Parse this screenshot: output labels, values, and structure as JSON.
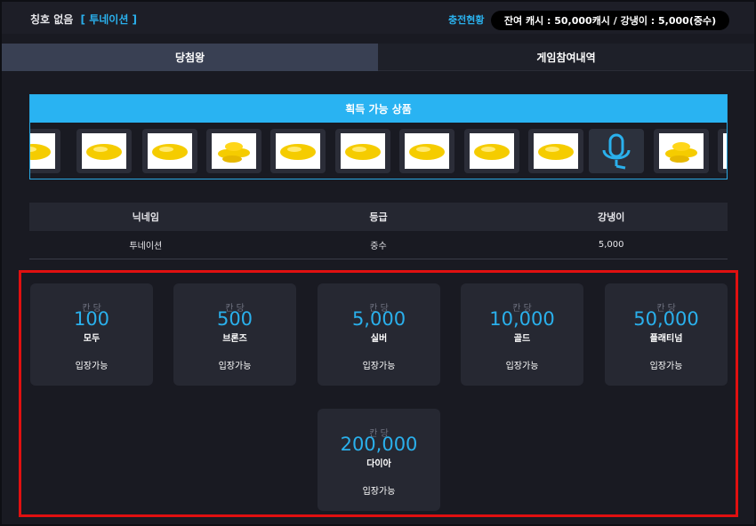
{
  "header": {
    "title_label": "칭호 없음",
    "nickname_bracket": "[ 투네이션 ]",
    "charge_link": "충전현황",
    "balance": "잔여 캐시 : 50,000캐시 / 강냉이 : 5,000(중수)"
  },
  "tabs": [
    {
      "label": "당첨왕",
      "active": true
    },
    {
      "label": "게임참여내역",
      "active": false
    }
  ],
  "prizes": {
    "title": "획득 가능 상품",
    "items": [
      {
        "icon": "corn-icon"
      },
      {
        "icon": "corn-icon"
      },
      {
        "icon": "corn-icon"
      },
      {
        "icon": "corn-pile-icon"
      },
      {
        "icon": "corn-icon"
      },
      {
        "icon": "corn-icon"
      },
      {
        "icon": "corn-icon"
      },
      {
        "icon": "corn-icon"
      },
      {
        "icon": "corn-icon"
      },
      {
        "icon": "microphone-icon"
      },
      {
        "icon": "corn-pile-icon"
      },
      {
        "icon": "corn-icon"
      }
    ]
  },
  "info_table": {
    "headers": [
      "닉네임",
      "등급",
      "강냉이"
    ],
    "row": [
      "투네이션",
      "중수",
      "5,000"
    ]
  },
  "rooms": [
    {
      "unit": "칸 당",
      "amount": "100",
      "grade": "모두",
      "status": "입장가능"
    },
    {
      "unit": "칸 당",
      "amount": "500",
      "grade": "브론즈",
      "status": "입장가능"
    },
    {
      "unit": "칸 당",
      "amount": "5,000",
      "grade": "실버",
      "status": "입장가능"
    },
    {
      "unit": "칸 당",
      "amount": "10,000",
      "grade": "골드",
      "status": "입장가능"
    },
    {
      "unit": "칸 당",
      "amount": "50,000",
      "grade": "플래티넘",
      "status": "입장가능"
    },
    {
      "unit": "칸 당",
      "amount": "200,000",
      "grade": "다이아",
      "status": "입장가능"
    }
  ],
  "colors": {
    "accent": "#2ab0ec",
    "highlight_border": "#e01010",
    "prize_header": "#29b3f2",
    "corn": "#f5cc00"
  }
}
